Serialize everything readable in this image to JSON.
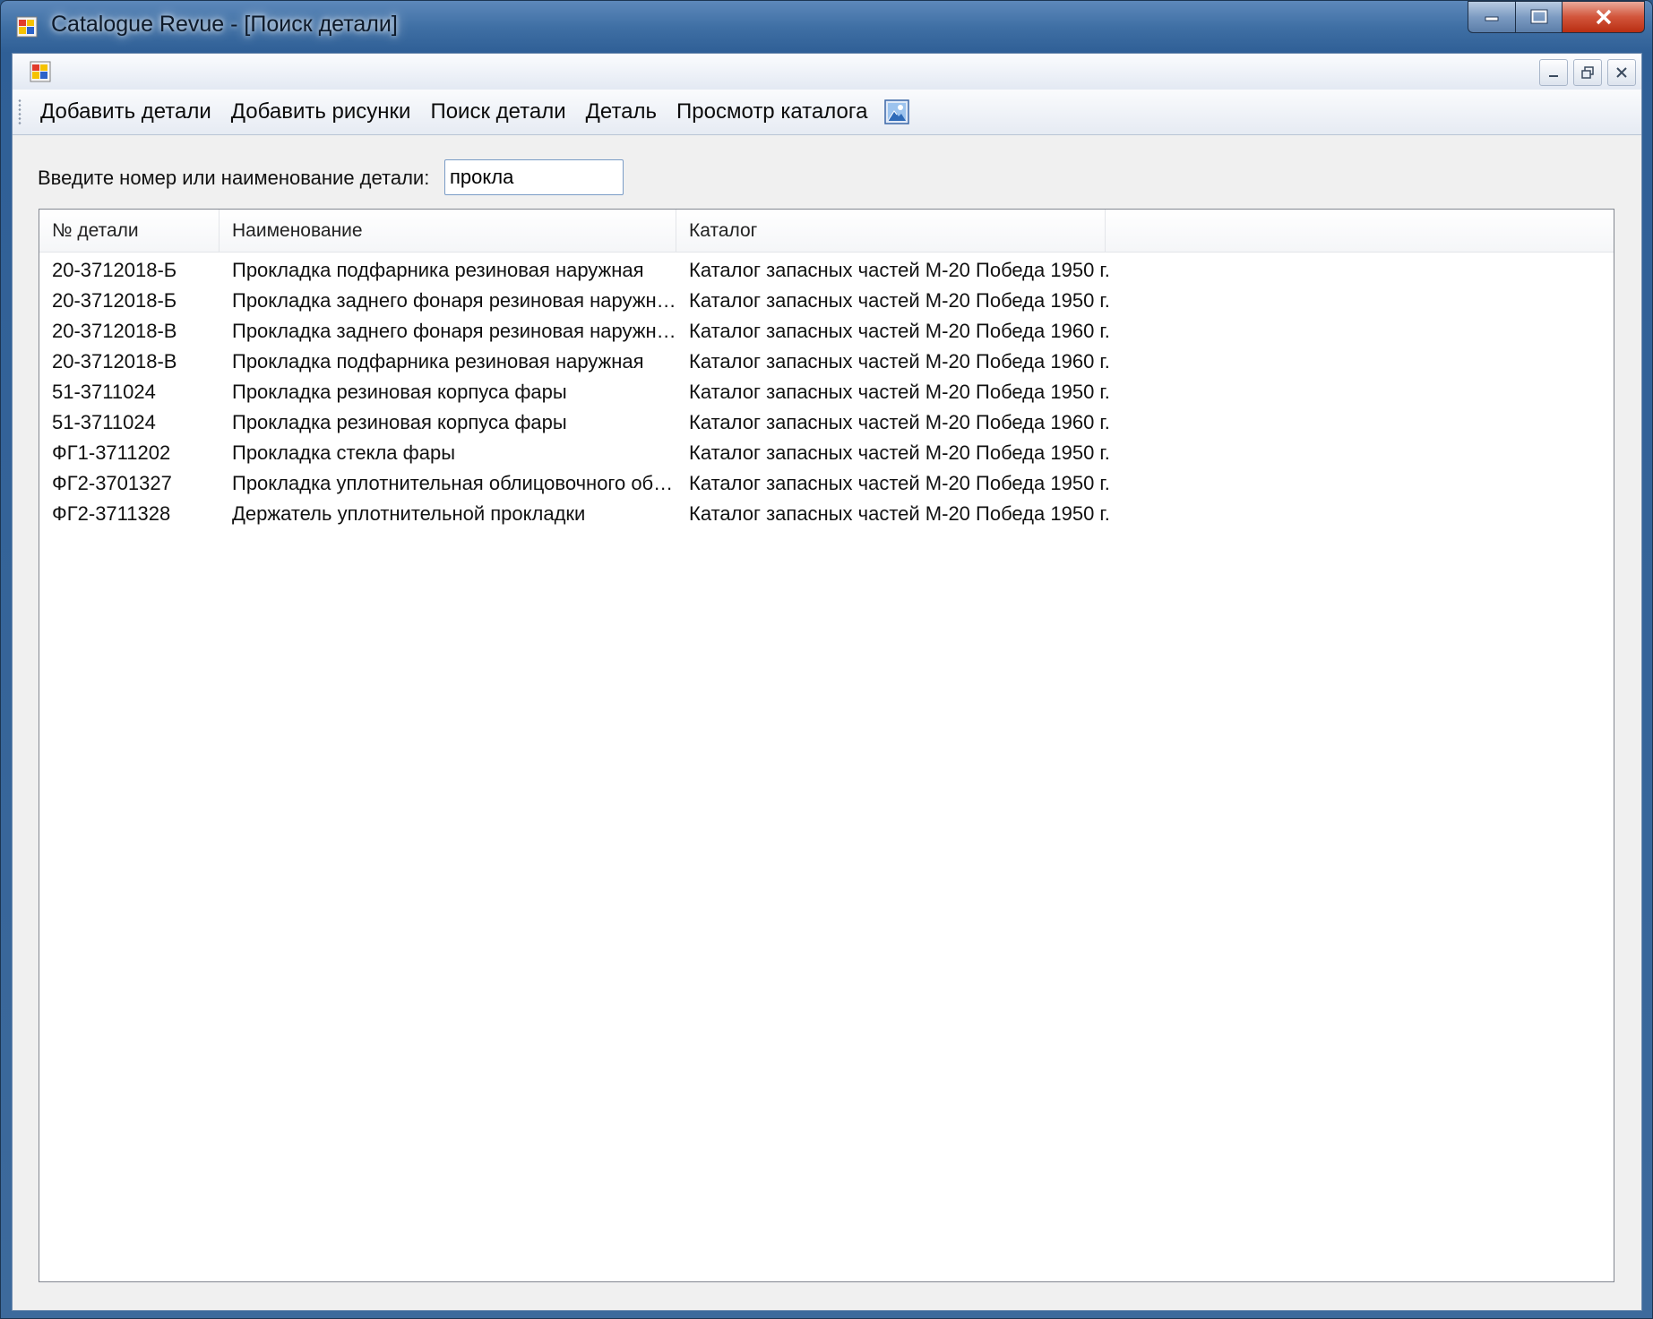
{
  "window": {
    "title": "Catalogue Revue - [Поиск детали]"
  },
  "toolbar": {
    "items": [
      "Добавить детали",
      "Добавить рисунки",
      "Поиск детали",
      "Деталь",
      "Просмотр каталога"
    ],
    "image_icon": "picture-icon"
  },
  "search": {
    "label": "Введите номер или наименование детали:",
    "value": "прокла"
  },
  "table": {
    "columns": [
      "№ детали",
      "Наименование",
      "Каталог"
    ],
    "rows": [
      [
        "20-3712018-Б",
        "Прокладка подфарника резиновая наружная",
        "Каталог запасных частей М-20 Победа 1950 г."
      ],
      [
        "20-3712018-Б",
        "Прокладка заднего фонаря резиновая наружная",
        "Каталог запасных частей М-20 Победа 1950 г."
      ],
      [
        "20-3712018-В",
        "Прокладка заднего фонаря резиновая наружная",
        "Каталог запасных частей М-20 Победа 1960 г."
      ],
      [
        "20-3712018-В",
        "Прокладка подфарника резиновая наружная",
        "Каталог запасных частей М-20 Победа 1960 г."
      ],
      [
        "51-3711024",
        "Прокладка резиновая корпуса фары",
        "Каталог запасных частей М-20 Победа 1950 г."
      ],
      [
        "51-3711024",
        "Прокладка резиновая корпуса фары",
        "Каталог запасных частей М-20 Победа 1960 г."
      ],
      [
        "ФГ1-3711202",
        "Прокладка стекла фары",
        "Каталог запасных частей М-20 Победа 1950 г."
      ],
      [
        "ФГ2-3701327",
        "Прокладка уплотнительная облицовочного ободка фа...",
        "Каталог запасных частей М-20 Победа 1950 г."
      ],
      [
        "ФГ2-3711328",
        "Держатель уплотнительной прокладки",
        "Каталог запасных частей М-20 Победа 1950 г."
      ]
    ]
  },
  "colors": {
    "frame": "#3f6fa4",
    "close_button": "#d2553b",
    "client_bg": "#f0f0f0",
    "input_border": "#7a9cc6"
  }
}
